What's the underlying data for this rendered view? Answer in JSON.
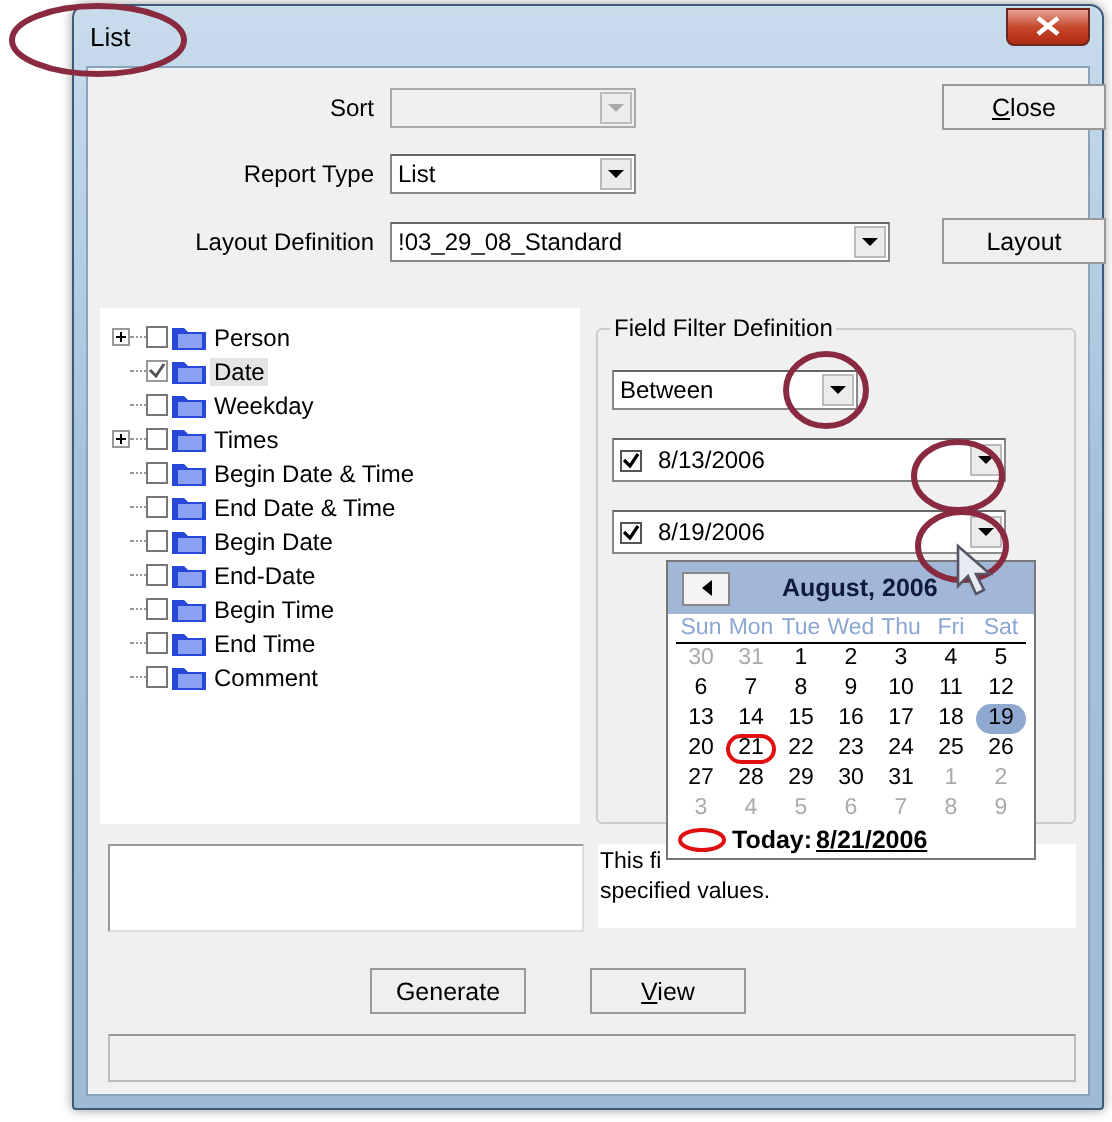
{
  "window": {
    "title": "List"
  },
  "form": {
    "sort": {
      "label": "Sort",
      "disabled": true
    },
    "report_type": {
      "label": "Report Type",
      "value": "List"
    },
    "layout_definition": {
      "label": "Layout Definition",
      "value": "!03_29_08_Standard"
    }
  },
  "buttons_top": [
    {
      "label": "Close",
      "underline_first": true
    },
    {
      "label": "Layout",
      "underline_first": false
    }
  ],
  "tree": [
    {
      "label": "Person",
      "checked": false,
      "expandable": true,
      "selected": false
    },
    {
      "label": "Date",
      "checked": true,
      "expandable": false,
      "selected": true
    },
    {
      "label": "Weekday",
      "checked": false,
      "expandable": false,
      "selected": false
    },
    {
      "label": "Times",
      "checked": false,
      "expandable": true,
      "selected": false
    },
    {
      "label": "Begin Date & Time",
      "checked": false,
      "expandable": false,
      "selected": false
    },
    {
      "label": "End Date & Time",
      "checked": false,
      "expandable": false,
      "selected": false
    },
    {
      "label": "Begin Date",
      "checked": false,
      "expandable": false,
      "selected": false
    },
    {
      "label": "End-Date",
      "checked": false,
      "expandable": false,
      "selected": false
    },
    {
      "label": "Begin Time",
      "checked": false,
      "expandable": false,
      "selected": false
    },
    {
      "label": "End Time",
      "checked": false,
      "expandable": false,
      "selected": false
    },
    {
      "label": "Comment",
      "checked": false,
      "expandable": false,
      "selected": false
    }
  ],
  "filter": {
    "title": "Field Filter Definition",
    "operator": "Between",
    "dates": [
      {
        "value": "8/13/2006",
        "checked": true
      },
      {
        "value": "8/19/2006",
        "checked": true
      }
    ]
  },
  "calendar": {
    "title": "August, 2006",
    "weekdays": [
      "Sun",
      "Mon",
      "Tue",
      "Wed",
      "Thu",
      "Fri",
      "Sat"
    ],
    "weeks": [
      [
        {
          "d": "30",
          "other": true,
          "selected": false,
          "today": false
        },
        {
          "d": "31",
          "other": true,
          "selected": false,
          "today": false
        },
        {
          "d": "1",
          "other": false,
          "selected": false,
          "today": false
        },
        {
          "d": "2",
          "other": false,
          "selected": false,
          "today": false
        },
        {
          "d": "3",
          "other": false,
          "selected": false,
          "today": false
        },
        {
          "d": "4",
          "other": false,
          "selected": false,
          "today": false
        },
        {
          "d": "5",
          "other": false,
          "selected": false,
          "today": false
        }
      ],
      [
        {
          "d": "6",
          "other": false,
          "selected": false,
          "today": false
        },
        {
          "d": "7",
          "other": false,
          "selected": false,
          "today": false
        },
        {
          "d": "8",
          "other": false,
          "selected": false,
          "today": false
        },
        {
          "d": "9",
          "other": false,
          "selected": false,
          "today": false
        },
        {
          "d": "10",
          "other": false,
          "selected": false,
          "today": false
        },
        {
          "d": "11",
          "other": false,
          "selected": false,
          "today": false
        },
        {
          "d": "12",
          "other": false,
          "selected": false,
          "today": false
        }
      ],
      [
        {
          "d": "13",
          "other": false,
          "selected": false,
          "today": false
        },
        {
          "d": "14",
          "other": false,
          "selected": false,
          "today": false
        },
        {
          "d": "15",
          "other": false,
          "selected": false,
          "today": false
        },
        {
          "d": "16",
          "other": false,
          "selected": false,
          "today": false
        },
        {
          "d": "17",
          "other": false,
          "selected": false,
          "today": false
        },
        {
          "d": "18",
          "other": false,
          "selected": false,
          "today": false
        },
        {
          "d": "19",
          "other": false,
          "selected": true,
          "today": false
        }
      ],
      [
        {
          "d": "20",
          "other": false,
          "selected": false,
          "today": false
        },
        {
          "d": "21",
          "other": false,
          "selected": false,
          "today": true
        },
        {
          "d": "22",
          "other": false,
          "selected": false,
          "today": false
        },
        {
          "d": "23",
          "other": false,
          "selected": false,
          "today": false
        },
        {
          "d": "24",
          "other": false,
          "selected": false,
          "today": false
        },
        {
          "d": "25",
          "other": false,
          "selected": false,
          "today": false
        },
        {
          "d": "26",
          "other": false,
          "selected": false,
          "today": false
        }
      ],
      [
        {
          "d": "27",
          "other": false,
          "selected": false,
          "today": false
        },
        {
          "d": "28",
          "other": false,
          "selected": false,
          "today": false
        },
        {
          "d": "29",
          "other": false,
          "selected": false,
          "today": false
        },
        {
          "d": "30",
          "other": false,
          "selected": false,
          "today": false
        },
        {
          "d": "31",
          "other": false,
          "selected": false,
          "today": false
        },
        {
          "d": "1",
          "other": true,
          "selected": false,
          "today": false
        },
        {
          "d": "2",
          "other": true,
          "selected": false,
          "today": false
        }
      ],
      [
        {
          "d": "3",
          "other": true,
          "selected": false,
          "today": false
        },
        {
          "d": "4",
          "other": true,
          "selected": false,
          "today": false
        },
        {
          "d": "5",
          "other": true,
          "selected": false,
          "today": false
        },
        {
          "d": "6",
          "other": true,
          "selected": false,
          "today": false
        },
        {
          "d": "7",
          "other": true,
          "selected": false,
          "today": false
        },
        {
          "d": "8",
          "other": true,
          "selected": false,
          "today": false
        },
        {
          "d": "9",
          "other": true,
          "selected": false,
          "today": false
        }
      ]
    ],
    "today_label": "Today:",
    "today_value": "8/21/2006"
  },
  "description": [
    "This fi",
    "specified values."
  ],
  "buttons_bottom": [
    {
      "label": "Generate",
      "underline_first": false
    },
    {
      "label": "View",
      "underline_first": true
    }
  ]
}
